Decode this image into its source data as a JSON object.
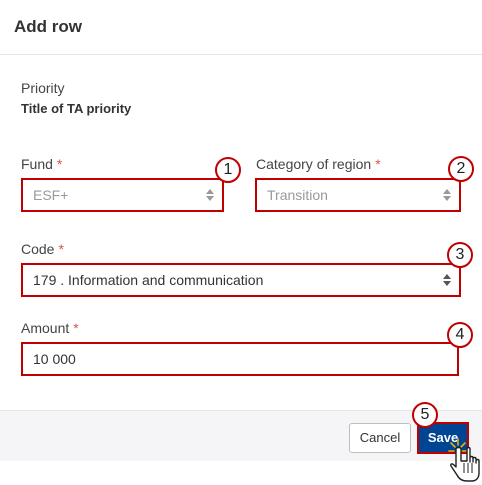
{
  "dialog": {
    "title": "Add row",
    "priority": {
      "label": "Priority",
      "value": "Title of TA priority"
    },
    "fund": {
      "label": "Fund",
      "required_mark": "*",
      "value": "ESF+"
    },
    "category_of_region": {
      "label": "Category of region",
      "required_mark": "*",
      "value": "Transition"
    },
    "code": {
      "label": "Code",
      "required_mark": "*",
      "value": "179 . Information and communication"
    },
    "amount": {
      "label": "Amount",
      "required_mark": "*",
      "value": "10 000"
    },
    "buttons": {
      "cancel": "Cancel",
      "save": "Save"
    }
  },
  "callouts": [
    "1",
    "2",
    "3",
    "4",
    "5"
  ],
  "colors": {
    "highlight": "#c00000",
    "primary": "#004494",
    "required": "#d9534f"
  },
  "icons": {
    "select_arrows": "sort-arrows-icon",
    "cursor": "hand-pointer-icon"
  }
}
